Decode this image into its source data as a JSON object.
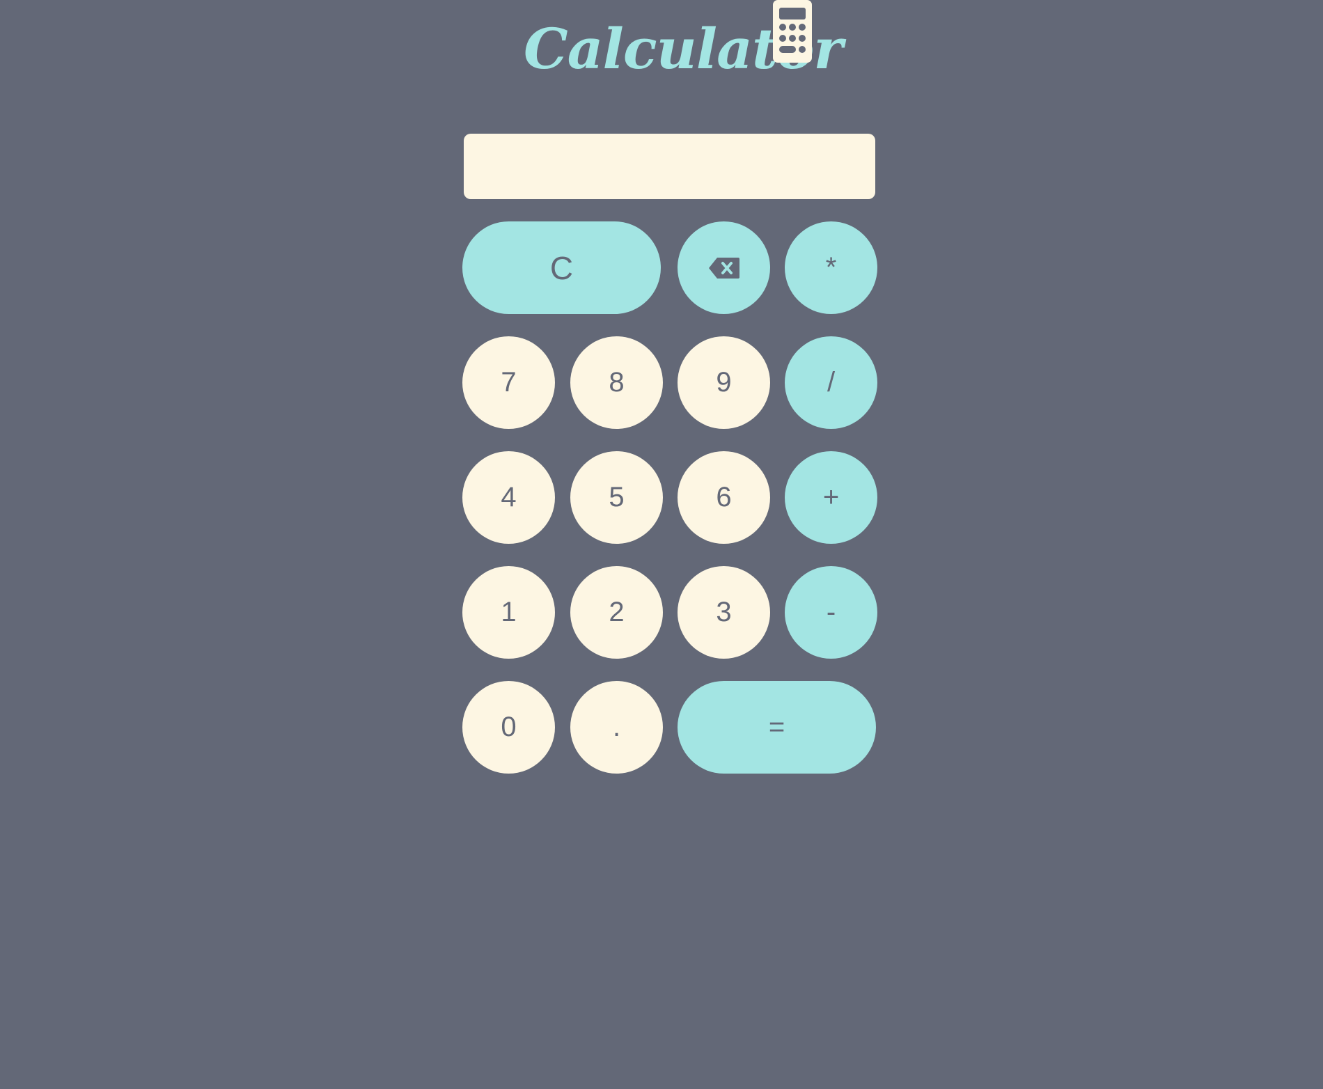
{
  "header": {
    "title": "Calculator",
    "icon": "calculator-icon"
  },
  "display": {
    "value": ""
  },
  "colors": {
    "background": "#636877",
    "accent": "#a3e5e3",
    "cream": "#fdf6e3",
    "text": "#636877"
  },
  "buttons": {
    "clear": "C",
    "backspace_icon": "backspace-icon",
    "multiply": "*",
    "divide": "/",
    "add": "+",
    "subtract": "-",
    "equals": "=",
    "decimal": ".",
    "seven": "7",
    "eight": "8",
    "nine": "9",
    "four": "4",
    "five": "5",
    "six": "6",
    "one": "1",
    "two": "2",
    "three": "3",
    "zero": "0"
  }
}
